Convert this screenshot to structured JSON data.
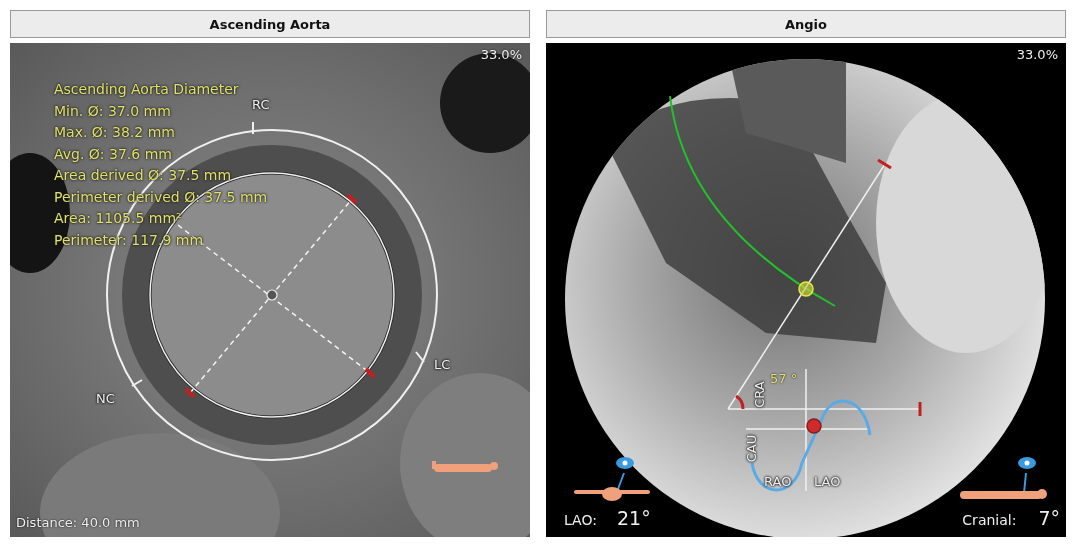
{
  "panels": [
    {
      "kind": "ct",
      "title": "Ascending Aorta",
      "zoom": "33.0%",
      "measurement": {
        "title": "Ascending Aorta Diameter",
        "lines": [
          "Min. Ø: 37.0 mm",
          "Max. Ø: 38.2 mm",
          "Avg. Ø: 37.6 mm",
          "Area derived Ø: 37.5 mm",
          "Perimeter derived Ø: 37.5 mm",
          "Area: 1105.5 mm²",
          "Perimeter: 117.9 mm"
        ]
      },
      "cusp_labels": [
        "RC",
        "LC",
        "NC"
      ],
      "distance": "Distance: 40.0 mm"
    },
    {
      "kind": "angio",
      "title": "Angio",
      "zoom": "33.0%",
      "angle": "57 °",
      "axis_labels": [
        "CRA",
        "CAU",
        "RAO",
        "LAO"
      ],
      "readouts": [
        {
          "label": "LAO:",
          "value": "21°"
        },
        {
          "label": "Cranial:",
          "value": "7°"
        }
      ]
    }
  ]
}
